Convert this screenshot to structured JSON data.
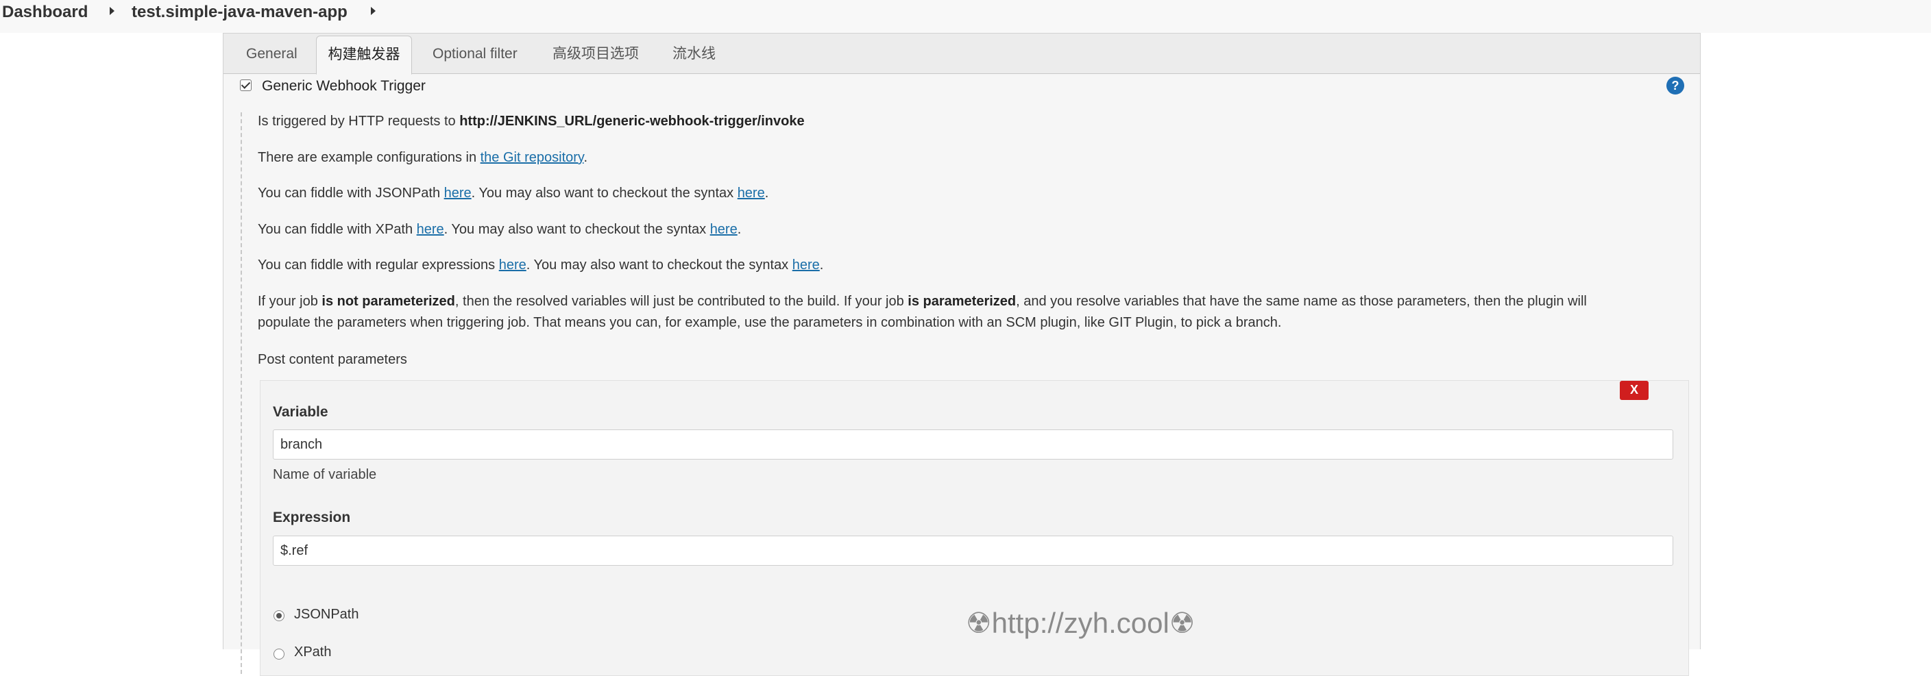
{
  "breadcrumb": {
    "items": [
      "Dashboard",
      "test.simple-java-maven-app"
    ]
  },
  "tabs": [
    "General",
    "构建触发器",
    "Optional filter",
    "高级项目选项",
    "流水线"
  ],
  "trigger": {
    "label": "Generic Webhook Trigger",
    "checked": true,
    "help": "?"
  },
  "description": {
    "line1_pre": "Is triggered by HTTP requests to ",
    "line1_url": "http://JENKINS_URL/generic-webhook-trigger/invoke",
    "line2_pre": "There are example configurations in ",
    "line2_link": "the Git repository",
    "line2_post": ".",
    "jsonpath_pre": "You can fiddle with JSONPath ",
    "xpath_pre": "You can fiddle with XPath ",
    "regex_pre": "You can fiddle with regular expressions ",
    "here": "here",
    "syntax_mid": ". You may also want to checkout the syntax ",
    "period": ".",
    "param_p1": "If your job ",
    "param_b1": "is not parameterized",
    "param_p2": ", then the resolved variables will just be contributed to the build. If your job ",
    "param_b2": "is parameterized",
    "param_p3": ", and you resolve variables that have the same name as those parameters, then the plugin will",
    "param_line2": "populate the parameters when triggering job. That means you can, for example, use the parameters in combination with an SCM plugin, like GIT Plugin, to pick a branch."
  },
  "post_content": {
    "title": "Post content parameters",
    "delete_label": "X",
    "variable_label": "Variable",
    "variable_value": "branch",
    "variable_hint": "Name of variable",
    "expression_label": "Expression",
    "expression_value": "$.ref",
    "options": [
      "JSONPath",
      "XPath"
    ],
    "selected": "JSONPath"
  },
  "watermark": "☢http://zyh.cool☢",
  "colors": {
    "link": "#1a6ea8",
    "help_icon": "#1f6fb5",
    "delete_button": "#d01e1e"
  }
}
